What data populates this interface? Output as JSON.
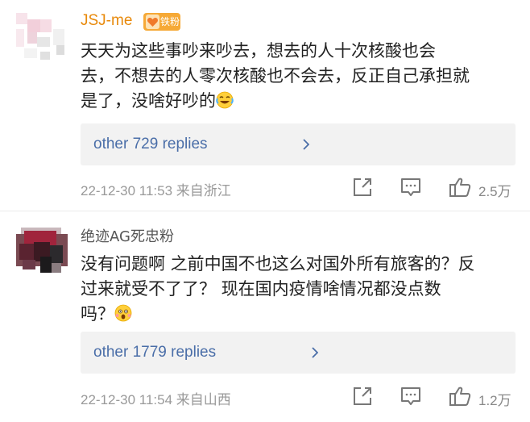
{
  "comments": [
    {
      "username": "JSJ-me",
      "badge": "铁粉",
      "avatar_icon": "pixelated-avatar-icon",
      "lines": [
        "天天为这些事吵来吵去，想去的人十次核酸也会",
        "去，不想去的人零次核酸也不会去，反正自己承担就",
        "是了，没啥好吵的"
      ],
      "emoji": "laughing-crying-emoji-icon",
      "replies_label": "other 729 replies",
      "timestamp": "22-12-30 11:53",
      "location": "来自浙江",
      "likes": "2.5万"
    },
    {
      "username": "绝迹AG死忠粉",
      "avatar_icon": "pixelated-avatar-icon",
      "lines": [
        "没有问题啊 之前中国不也这么对国外所有旅客的？反",
        "过来就受不了了？ 现在国内疫情啥情况都没点数",
        "吗？"
      ],
      "emoji": "shocked-face-emoji-icon",
      "replies_label": "other 1779 replies",
      "timestamp": "22-12-30 11:54",
      "location": "来自山西",
      "likes": "1.2万"
    }
  ],
  "colors": {
    "username_highlight": "#e8890a",
    "badge": "#f6a936",
    "link": "#4a6ea8",
    "meta": "#999999",
    "reply_bg": "#f2f2f2"
  }
}
